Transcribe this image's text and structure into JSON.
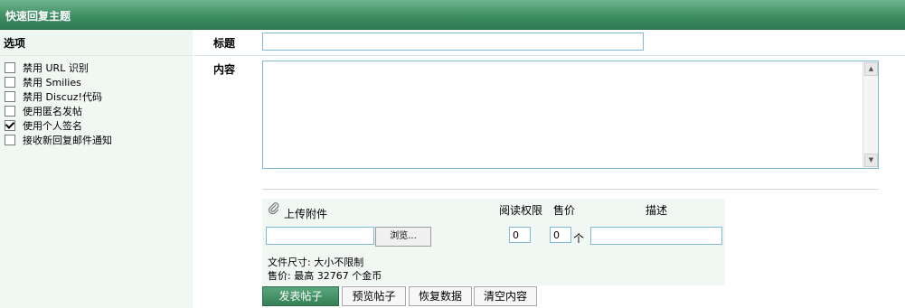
{
  "panel": {
    "title": "快速回复主题"
  },
  "left": {
    "header": "选项",
    "options": [
      {
        "label": "禁用 URL 识别",
        "checked": false
      },
      {
        "label": "禁用 Smilies",
        "checked": false
      },
      {
        "label": "禁用 Discuz!代码",
        "checked": false
      },
      {
        "label": "使用匿名发帖",
        "checked": false
      },
      {
        "label": "使用个人签名",
        "checked": true
      },
      {
        "label": "接收新回复邮件通知",
        "checked": false
      }
    ]
  },
  "form": {
    "title_label": "标题",
    "title_value": "",
    "content_label": "内容",
    "content_value": ""
  },
  "attachment": {
    "label": "上传附件",
    "read_perm_header": "阅读权限",
    "price_header": "售价",
    "desc_header": "描述",
    "browse_label": "浏览...",
    "read_perm_value": "0",
    "price_value": "0",
    "price_unit": "个",
    "size_info": "文件尺寸: 大小不限制",
    "price_info": "售价: 最高 32767 个金币"
  },
  "buttons": {
    "submit": "发表帖子",
    "preview": "预览帖子",
    "restore": "恢复数据",
    "clear": "清空内容"
  },
  "colors": {
    "header_green": "#3f8e63",
    "panel_bg": "#f1f8f3",
    "input_border": "#7fb9d6"
  }
}
